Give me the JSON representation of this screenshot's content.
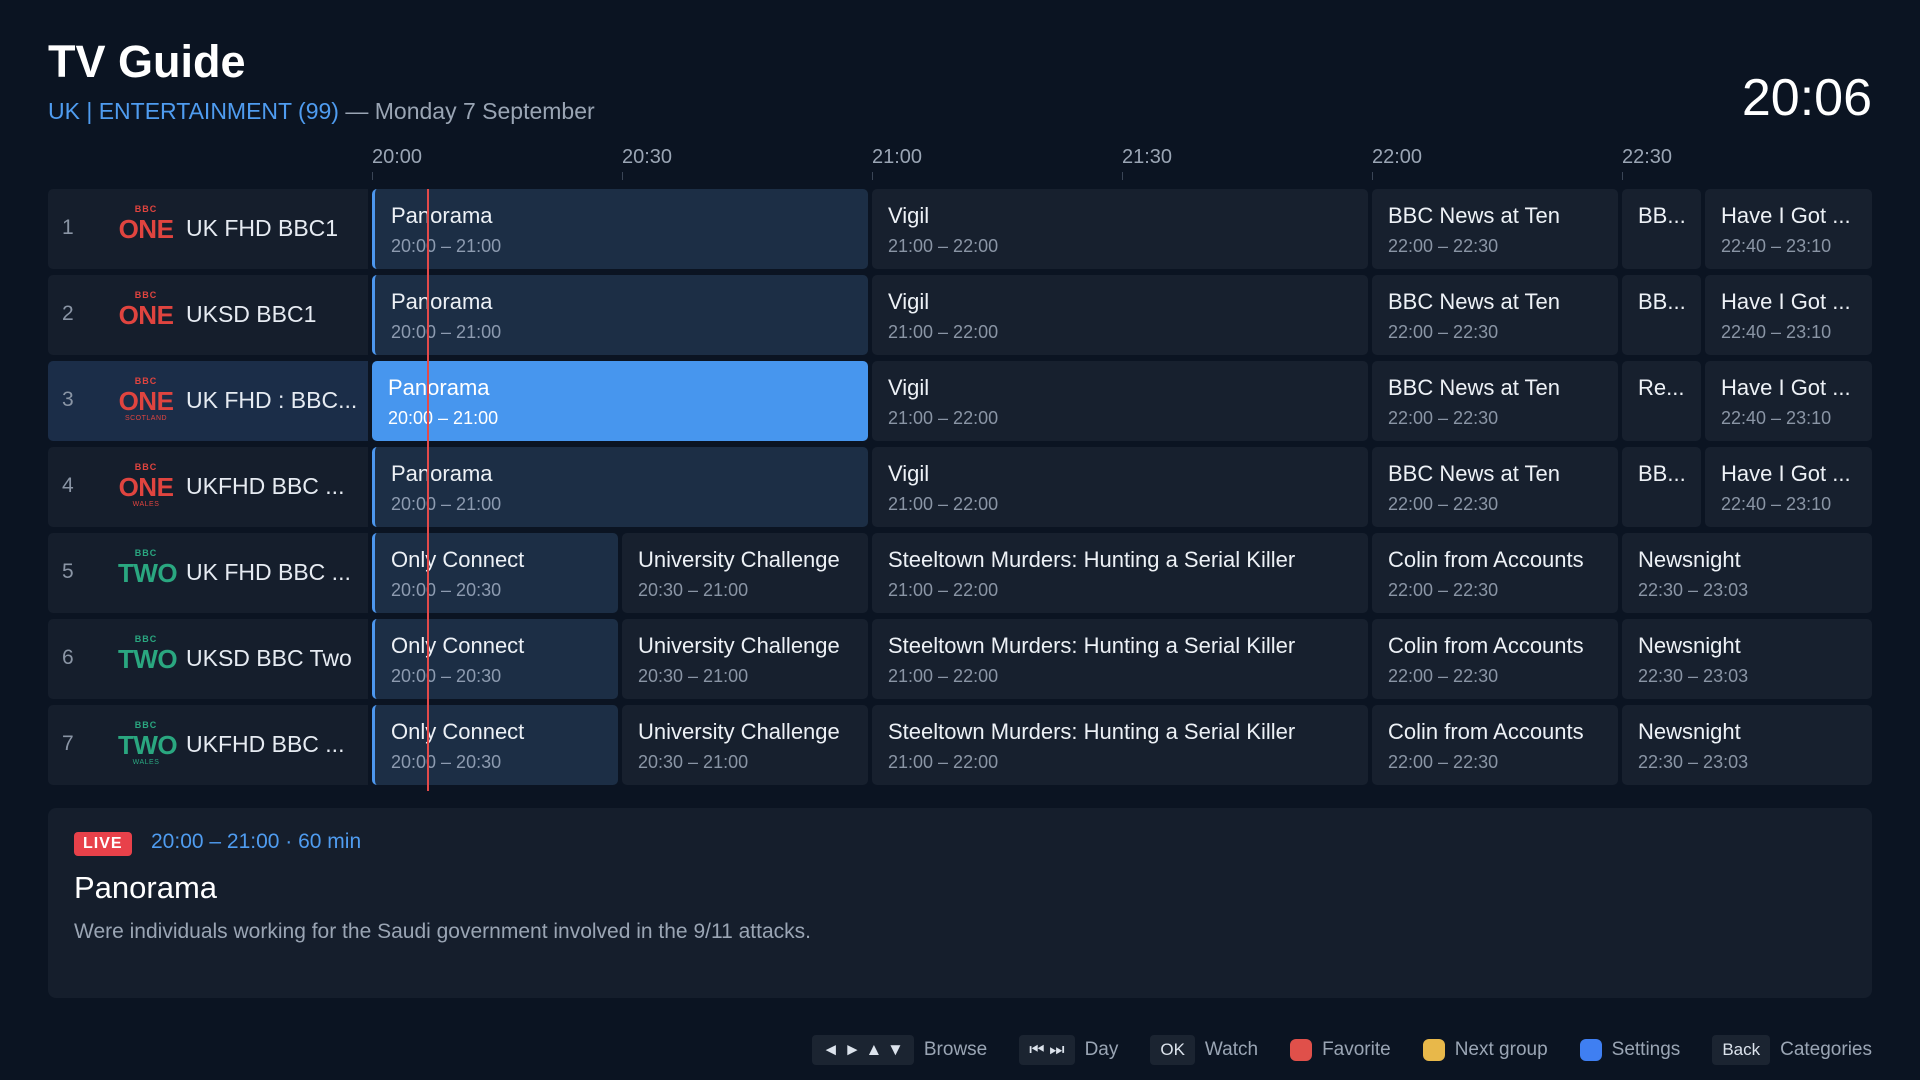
{
  "header": {
    "title": "TV Guide",
    "group": "UK | ENTERTAINMENT (99)",
    "separator": " — ",
    "date": "Monday 7 September",
    "clock": "20:06"
  },
  "timebar": [
    "20:00",
    "20:30",
    "21:00",
    "21:30",
    "22:00",
    "22:30"
  ],
  "channels": [
    {
      "num": "1",
      "logo_top": "BBC",
      "logo_main": "ONE",
      "logo_region": "",
      "name": "UK FHD BBC1",
      "programs": [
        {
          "title": "Panorama",
          "time": "20:00 – 21:00"
        },
        {
          "title": "Vigil",
          "time": "21:00 – 22:00"
        },
        {
          "title": "BBC News at Ten",
          "time": "22:00 – 22:30"
        },
        {
          "title": "BB...",
          "time": ""
        },
        {
          "title": "Have I Got ...",
          "time": "22:40 – 23:10"
        }
      ]
    },
    {
      "num": "2",
      "logo_top": "BBC",
      "logo_main": "ONE",
      "logo_region": "",
      "name": "UKSD BBC1",
      "programs": [
        {
          "title": "Panorama",
          "time": "20:00 – 21:00"
        },
        {
          "title": "Vigil",
          "time": "21:00 – 22:00"
        },
        {
          "title": "BBC News at Ten",
          "time": "22:00 – 22:30"
        },
        {
          "title": "BB...",
          "time": ""
        },
        {
          "title": "Have I Got ...",
          "time": "22:40 – 23:10"
        }
      ]
    },
    {
      "num": "3",
      "logo_top": "BBC",
      "logo_main": "ONE",
      "logo_region": "SCOTLAND",
      "name": "UK FHD : BBC...",
      "programs": [
        {
          "title": "Panorama",
          "time": "20:00 – 21:00"
        },
        {
          "title": "Vigil",
          "time": "21:00 – 22:00"
        },
        {
          "title": "BBC News at Ten",
          "time": "22:00 – 22:30"
        },
        {
          "title": "Re...",
          "time": ""
        },
        {
          "title": "Have I Got ...",
          "time": "22:40 – 23:10"
        }
      ]
    },
    {
      "num": "4",
      "logo_top": "BBC",
      "logo_main": "ONE",
      "logo_region": "WALES",
      "name": "UKFHD BBC ...",
      "programs": [
        {
          "title": "Panorama",
          "time": "20:00 – 21:00"
        },
        {
          "title": "Vigil",
          "time": "21:00 – 22:00"
        },
        {
          "title": "BBC News at Ten",
          "time": "22:00 – 22:30"
        },
        {
          "title": "BB...",
          "time": ""
        },
        {
          "title": "Have I Got ...",
          "time": "22:40 – 23:10"
        }
      ]
    },
    {
      "num": "5",
      "logo_top": "BBC",
      "logo_main": "TWO",
      "logo_region": "",
      "name": "UK FHD BBC ...",
      "programs": [
        {
          "title": "Only Connect",
          "time": "20:00 – 20:30"
        },
        {
          "title": "University Challenge",
          "time": "20:30 – 21:00"
        },
        {
          "title": "Steeltown Murders: Hunting a Serial Killer",
          "time": "21:00 – 22:00"
        },
        {
          "title": "Colin from Accounts",
          "time": "22:00 – 22:30"
        },
        {
          "title": "Newsnight",
          "time": "22:30 – 23:03"
        }
      ]
    },
    {
      "num": "6",
      "logo_top": "BBC",
      "logo_main": "TWO",
      "logo_region": "",
      "name": "UKSD BBC Two",
      "programs": [
        {
          "title": "Only Connect",
          "time": "20:00 – 20:30"
        },
        {
          "title": "University Challenge",
          "time": "20:30 – 21:00"
        },
        {
          "title": "Steeltown Murders: Hunting a Serial Killer",
          "time": "21:00 – 22:00"
        },
        {
          "title": "Colin from Accounts",
          "time": "22:00 – 22:30"
        },
        {
          "title": "Newsnight",
          "time": "22:30 – 23:03"
        }
      ]
    },
    {
      "num": "7",
      "logo_top": "BBC",
      "logo_main": "TWO",
      "logo_region": "WALES",
      "name": "UKFHD BBC ...",
      "programs": [
        {
          "title": "Only Connect",
          "time": "20:00 – 20:30"
        },
        {
          "title": "University Challenge",
          "time": "20:30 – 21:00"
        },
        {
          "title": "Steeltown Murders: Hunting a Serial Killer",
          "time": "21:00 – 22:00"
        },
        {
          "title": "Colin from Accounts",
          "time": "22:00 – 22:30"
        },
        {
          "title": "Newsnight",
          "time": "22:30 – 23:03"
        }
      ]
    }
  ],
  "info": {
    "badge": "LIVE",
    "time": "20:00 – 21:00 · 60 min",
    "title": "Panorama",
    "description": "Were individuals working for the Saudi government involved in the 9/11 attacks."
  },
  "footer": {
    "browse_key": "◄ ► ▲ ▼",
    "browse": "Browse",
    "day_key": "⏮ ⏭",
    "day": "Day",
    "ok_key": "OK",
    "watch": "Watch",
    "favorite": "Favorite",
    "next_group": "Next group",
    "settings": "Settings",
    "back_key": "Back",
    "categories": "Categories"
  },
  "colors": {
    "accent": "#4f9cf0",
    "now_line": "#e34a4a",
    "bbc_one": "#e0443f",
    "bbc_two": "#2aa780",
    "red": "#e0504a",
    "yellow": "#e8b84a",
    "blue": "#3f7ff2"
  }
}
